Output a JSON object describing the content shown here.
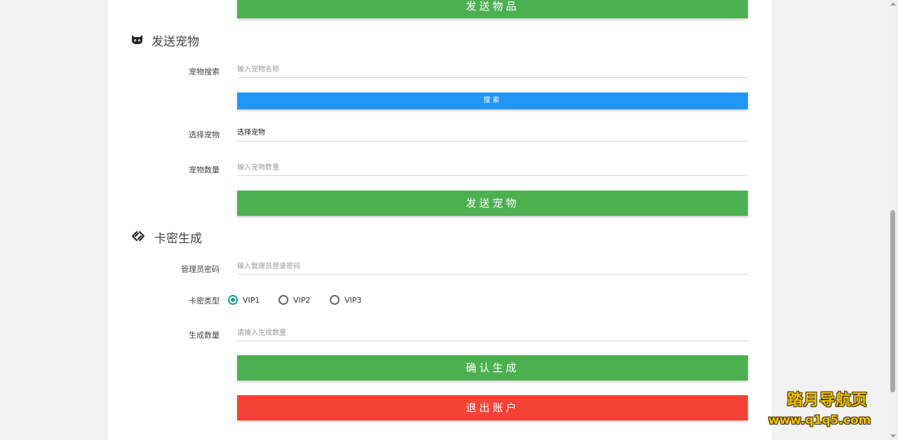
{
  "send_item": {
    "button_label": "发送物品"
  },
  "send_pet": {
    "title": "发送宠物",
    "icon": "cat-icon",
    "search_label": "宠物搜索",
    "search_placeholder": "输入宠物名称",
    "search_button": "搜索",
    "select_label": "选择宠物",
    "select_value": "选择宠物",
    "quantity_label": "宠物数量",
    "quantity_placeholder": "输入宠物数量",
    "send_button": "发送宠物"
  },
  "card_gen": {
    "title": "卡密生成",
    "icon": "link-icon",
    "admin_label": "管理员密码",
    "admin_placeholder": "输入管理员登录密码",
    "type_label": "卡密类型",
    "types": [
      {
        "label": "VIP1",
        "checked": true
      },
      {
        "label": "VIP2",
        "checked": false
      },
      {
        "label": "VIP3",
        "checked": false
      }
    ],
    "count_label": "生成数量",
    "count_placeholder": "请输入生成数量",
    "confirm_button": "确认生成",
    "logout_button": "退出账户"
  },
  "watermark": {
    "title": "踏月导航页",
    "url": "www.q1q5.com"
  },
  "colors": {
    "green": "#4caf50",
    "blue": "#2196f3",
    "red": "#f44336",
    "radio_accent": "#1a9a8a"
  }
}
